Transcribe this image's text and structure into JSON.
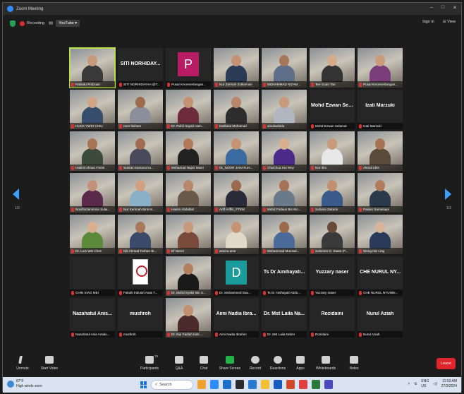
{
  "window": {
    "title": "Zoom Meeting",
    "controls": [
      "–",
      "□",
      "✕"
    ]
  },
  "topbar": {
    "recording_label": "Recording",
    "stream_label": "YouTube ▾",
    "signin": "Sign in",
    "view": "☰ View"
  },
  "pager": {
    "left": "1/2",
    "right": "1/2"
  },
  "tiles": [
    {
      "name": "Rabiatul Ridzuan",
      "kind": "video",
      "active": true,
      "skin": "#c79a7c",
      "shirt": "#3a3a3a"
    },
    {
      "name": "SITI NORHIDAYAH @T...",
      "big": "SITI NORHIDAY...",
      "kind": "name"
    },
    {
      "name": "Pusat Kecemerlangan...",
      "kind": "avatar",
      "letter": "P",
      "color": "#b81c64"
    },
    {
      "name": "Nur Zarinah Zulkarnain",
      "kind": "video",
      "skin": "#c49173",
      "shirt": "#2b3b55"
    },
    {
      "name": "MOHAMMAD NIZAM...",
      "kind": "video",
      "skin": "#a5765a",
      "shirt": "#5f6f8a"
    },
    {
      "name": "Tee Guan Tan",
      "kind": "video",
      "skin": "#d6ab8b",
      "shirt": "#333"
    },
    {
      "name": "Pusat Kecemerlangan...",
      "kind": "video",
      "skin": "#c99b7a",
      "shirt": "#7a3f7a"
    },
    {
      "name": "HUCK YWIH CHIU",
      "kind": "video",
      "skin": "#d0a586",
      "shirt": "#364d6b"
    },
    {
      "name": "noor hisham",
      "kind": "video",
      "skin": "#9e6b4c",
      "shirt": "#8a8f99"
    },
    {
      "name": "Dr. Ruhil Hayati Ham...",
      "kind": "video",
      "skin": "#c39273",
      "shirt": "#6b2b3b"
    },
    {
      "name": "Darliana Mohamad",
      "kind": "video",
      "skin": "#b8876a",
      "shirt": "#2d2d2d"
    },
    {
      "name": "ainulwahida",
      "kind": "video",
      "skin": "#c8997a",
      "shirt": "#b0b6c0"
    },
    {
      "name": "Mohd Ezwan Selamat",
      "big": "Mohd Ezwan Sel...",
      "kind": "name"
    },
    {
      "name": "Izati Marzuki",
      "big": "Izati Marzuki",
      "kind": "name"
    },
    {
      "name": "Hakimi Alman FSDK",
      "kind": "video",
      "skin": "#a87456",
      "shirt": "#3b4a3a"
    },
    {
      "name": "Sukran Kamaruzza...",
      "kind": "video",
      "skin": "#a06c50",
      "shirt": "#4a4a5a"
    },
    {
      "name": "Mohamad Najmi Masri",
      "kind": "video",
      "skin": "#b07a5a",
      "shirt": "#222"
    },
    {
      "name": "01_NOOR JANATUN...",
      "kind": "video",
      "skin": "#c59474",
      "shirt": "#3a6aa0"
    },
    {
      "name": "ChuChua Hui Wey",
      "kind": "video",
      "skin": "#d8b090",
      "shirt": "#4b2a8a"
    },
    {
      "name": "Nor Ilmi",
      "kind": "video",
      "skin": "#c89a7a",
      "shirt": "#e8e8e8"
    },
    {
      "name": "Akmal Idris",
      "kind": "video",
      "skin": "#a67454",
      "shirt": "#5a4a3a"
    },
    {
      "name": "Noorfarzanimma Sulai...",
      "kind": "video",
      "skin": "#c3917a",
      "shirt": "#5a2a4a"
    },
    {
      "name": "Nur Karimah Binti M...",
      "kind": "video",
      "skin": "#d0a080",
      "shirt": "#8ab0c8"
    },
    {
      "name": "Hanim Abdullah",
      "kind": "video",
      "skin": "#b8866a",
      "shirt": "#6a5a4a"
    },
    {
      "name": "Ariff Ariffin_FTKM",
      "kind": "video",
      "skin": "#9a6a4e",
      "shirt": "#2a2a3a"
    },
    {
      "name": "Mohd Firdaus Bin Mo...",
      "kind": "video",
      "skin": "#a47254",
      "shirt": "#6a7a8a"
    },
    {
      "name": "Suhana Zakaria",
      "kind": "video",
      "skin": "#c09070",
      "shirt": "#3a5a8a"
    },
    {
      "name": "Paisan Samasaye",
      "kind": "video",
      "skin": "#b07c5c",
      "shirt": "#2a3a4a"
    },
    {
      "name": "Dr. Lum Wei Chen",
      "kind": "video",
      "skin": "#d8b090",
      "shirt": "#5a8a3a"
    },
    {
      "name": "Nik Ahmad Farhan Bi...",
      "kind": "video",
      "skin": "#a87858",
      "shirt": "#3a4a6a"
    },
    {
      "name": "Ef Noren",
      "kind": "video",
      "skin": "#c8987a",
      "shirt": "#7a4a3a"
    },
    {
      "name": "asniza amir",
      "kind": "video",
      "skin": "#c49474",
      "shirt": "#e0d8c8"
    },
    {
      "name": "Mohammad Muzzad...",
      "kind": "video",
      "skin": "#9a6a4a",
      "shirt": "#4a6a9a"
    },
    {
      "name": "Solomon G. Zaato (P...",
      "kind": "video",
      "skin": "#6a4a38",
      "shirt": "#3a3a3a"
    },
    {
      "name": "Wong Hie Ling",
      "kind": "video",
      "skin": "#d8b49a",
      "shirt": "#2a3a5a"
    },
    {
      "name": "CHIN SIAO MEI",
      "kind": "blank"
    },
    {
      "name": "Fakulti Industri Asas T...",
      "kind": "logo"
    },
    {
      "name": "Dr. Mohd Syakir Bin S...",
      "kind": "video",
      "skin": "#b08060",
      "shirt": "#1a1a1a"
    },
    {
      "name": "Dr. Mohammed Dau...",
      "kind": "avatar",
      "letter": "D",
      "color": "#1a9a9a"
    },
    {
      "name": "Ts Dr Ainihayati Abdu...",
      "big": "Ts Dr Ainihayati...",
      "kind": "name"
    },
    {
      "name": "Yuzzary naser",
      "big": "Yuzzary naser",
      "kind": "name"
    },
    {
      "name": "CHE NURUL NYUNNI...",
      "big": "CHE NURUL NY...",
      "kind": "name"
    },
    {
      "name": "Nazahatul Anis Amalu...",
      "big": "Nazahatul Anis...",
      "kind": "name"
    },
    {
      "name": "musfiroh",
      "big": "musfiroh",
      "kind": "name"
    },
    {
      "name": "Dr. Nur Fadiah binti ...",
      "kind": "video",
      "skin": "#c09070",
      "shirt": "#4a2a2a"
    },
    {
      "name": "Aimi Nadia Ibrahim",
      "big": "Aimi Nadia Ibra...",
      "kind": "name"
    },
    {
      "name": "Dr. Mst Laila Naher",
      "big": "Dr. Mst Laila Na...",
      "kind": "name"
    },
    {
      "name": "Rozidaini",
      "big": "Rozidaini",
      "kind": "name"
    },
    {
      "name": "Nurul Aziah",
      "big": "Nurul Aziah",
      "kind": "name"
    }
  ],
  "toolbar": {
    "unmute": "Unmute",
    "start_video": "Start Video",
    "participants": "Participants",
    "participants_count": "76",
    "qa": "Q&A",
    "chat": "Chat",
    "share": "Share Screen",
    "record": "Record",
    "reactions": "Reactions",
    "apps": "Apps",
    "whiteboards": "Whiteboards",
    "notes": "Notes",
    "leave": "Leave"
  },
  "taskbar": {
    "temp": "87°F",
    "weather": "High winds soon",
    "search_placeholder": "Search",
    "lang": "ENG",
    "region": "US",
    "time": "11:53 AM",
    "date": "27/3/2024"
  }
}
